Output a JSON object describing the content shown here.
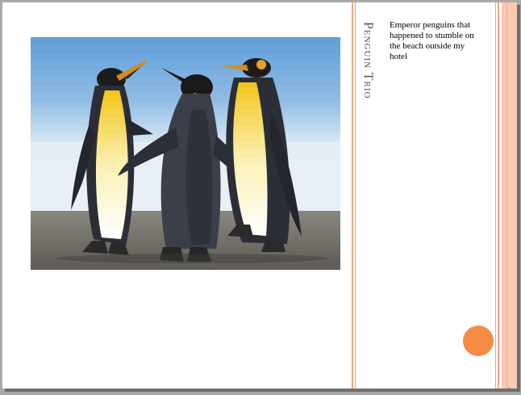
{
  "slide": {
    "title": "Penguin Trio",
    "caption": "Emperor penguins that happened to stumble on the beach outside my hotel"
  },
  "colors": {
    "accent": "#f58b45",
    "accent_light": "#fbc9b1",
    "line": "#f4a583",
    "title_text": "#505050"
  },
  "photo": {
    "subject": "penguins-photo"
  }
}
